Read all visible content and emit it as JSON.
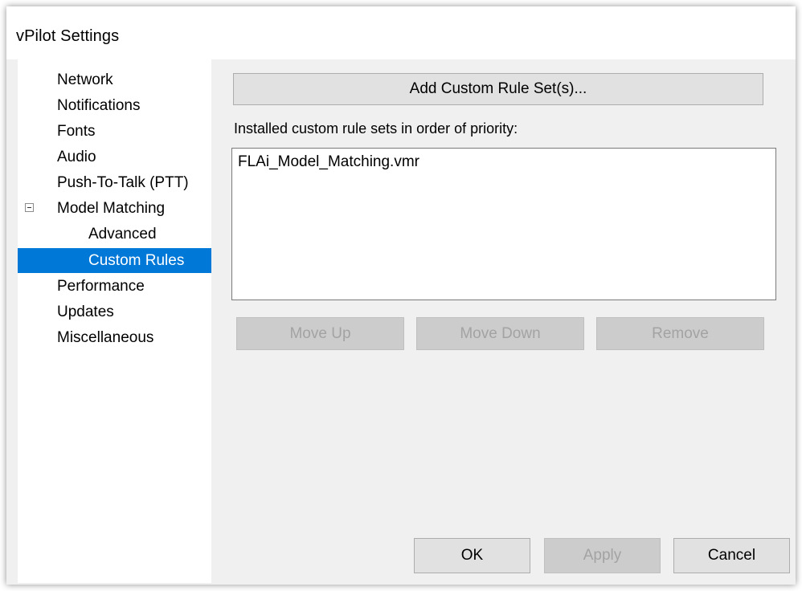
{
  "window": {
    "title": "vPilot Settings"
  },
  "nav": {
    "items": [
      {
        "label": "Network",
        "indent": 0
      },
      {
        "label": "Notifications",
        "indent": 0
      },
      {
        "label": "Fonts",
        "indent": 0
      },
      {
        "label": "Audio",
        "indent": 0
      },
      {
        "label": "Push-To-Talk (PTT)",
        "indent": 0
      },
      {
        "label": "Model Matching",
        "indent": 0,
        "expanded": true
      },
      {
        "label": "Advanced",
        "indent": 1
      },
      {
        "label": "Custom Rules",
        "indent": 1,
        "selected": true
      },
      {
        "label": "Performance",
        "indent": 0
      },
      {
        "label": "Updates",
        "indent": 0
      },
      {
        "label": "Miscellaneous",
        "indent": 0
      }
    ]
  },
  "main": {
    "add_button_label": "Add Custom Rule Set(s)...",
    "list_label": "Installed custom rule sets in order of priority:",
    "rule_sets": [
      "FLAi_Model_Matching.vmr"
    ],
    "move_up_label": "Move Up",
    "move_down_label": "Move Down",
    "remove_label": "Remove"
  },
  "footer": {
    "ok_label": "OK",
    "apply_label": "Apply",
    "cancel_label": "Cancel"
  },
  "colors": {
    "selection": "#0078d7",
    "window_bg": "#f0f0f0",
    "button_bg": "#e1e1e1",
    "disabled_button_bg": "#cccccc"
  }
}
